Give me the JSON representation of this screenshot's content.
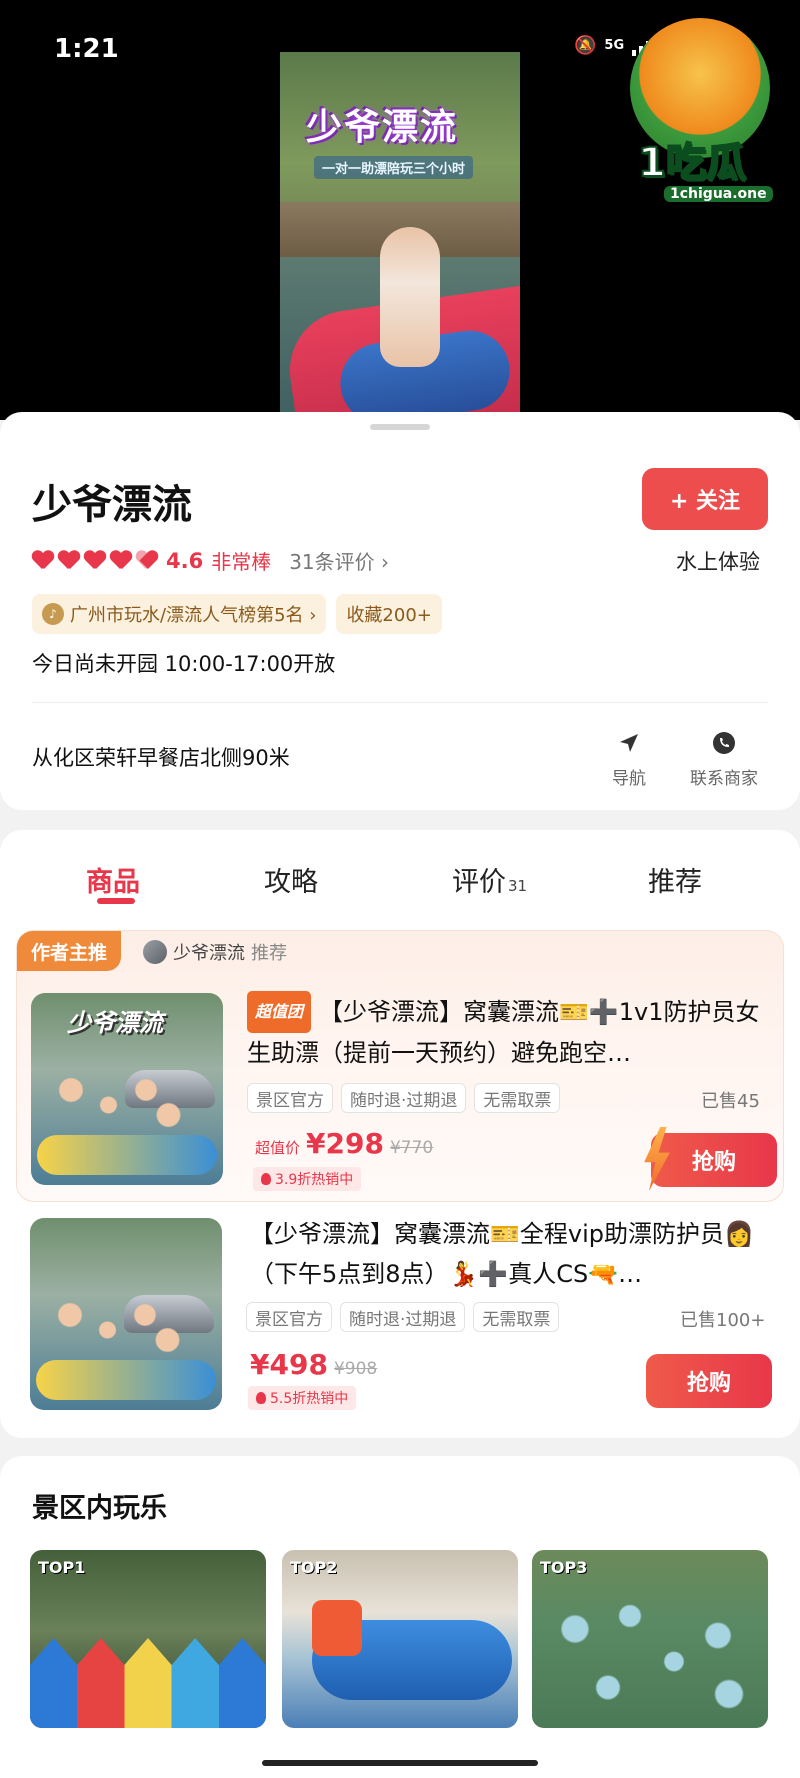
{
  "status_bar": {
    "time": "1:21",
    "network": "5G"
  },
  "video": {
    "title": "少爷漂流",
    "subtitle": "一对一助漂陪玩三个小时"
  },
  "watermark": {
    "brand": "1吃瓜",
    "url": "1chigua.one"
  },
  "shop": {
    "name": "少爷漂流",
    "follow_label": "+ 关注",
    "score": "4.6",
    "score_label": "非常棒",
    "reviews": "31条评价 ›",
    "category": "水上体验",
    "rank_tag": "广州市玩水/漂流人气榜第5名 ›",
    "fav_tag": "收藏200+",
    "hours": "今日尚未开园 10:00-17:00开放",
    "address": "从化区荣轩早餐店北侧90米",
    "nav_label": "导航",
    "contact_label": "联系商家"
  },
  "tabs": [
    {
      "label": "商品"
    },
    {
      "label": "攻略"
    },
    {
      "label": "评价",
      "count": "31"
    },
    {
      "label": "推荐"
    }
  ],
  "featured": {
    "badge": "作者主推",
    "rec_name": "少爷漂流",
    "rec_suffix": "推荐"
  },
  "products": [
    {
      "image_title": "少爷漂流",
      "badge": "超值团",
      "title": "【少爷漂流】窝囊漂流🎫➕1v1防护员女生助漂（提前一天预约）避免跑空…",
      "chips": [
        "景区官方",
        "随时退·过期退",
        "无需取票"
      ],
      "sold": "已售45",
      "price_label": "超值价",
      "price": "¥298",
      "orig_price": "¥770",
      "discount": "3.9折热销中",
      "buy_label": "抢购"
    },
    {
      "title": "【少爷漂流】窝囊漂流🎫全程vip助漂防护员👩（下午5点到8点）💃➕真人CS🔫…",
      "chips": [
        "景区官方",
        "随时退·过期退",
        "无需取票"
      ],
      "sold": "已售100+",
      "price": "¥498",
      "orig_price": "¥908",
      "discount": "5.5折热销中",
      "buy_label": "抢购"
    }
  ],
  "fun": {
    "title": "景区内玩乐",
    "items": [
      {
        "tag": "TOP1"
      },
      {
        "tag": "TOP2"
      },
      {
        "tag": "TOP3"
      }
    ]
  }
}
